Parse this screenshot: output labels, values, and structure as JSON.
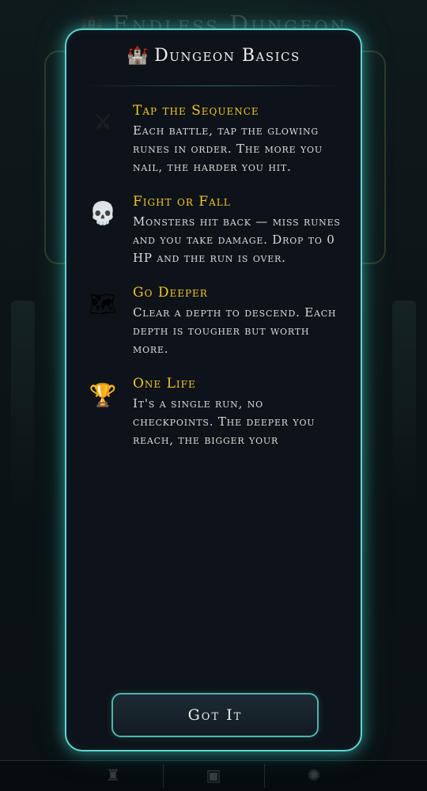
{
  "background": {
    "title": "Endless Dungeon",
    "nav_icons": [
      "castle-icon",
      "chest-icon",
      "medallion-icon"
    ]
  },
  "modal": {
    "title": "Dungeon Basics",
    "title_icon": "castle-icon",
    "rules": [
      {
        "icon": "swords-icon",
        "glyph": "⚔",
        "title": "Tap the Sequence",
        "text": "Each battle, tap the glowing runes in order. The more you nail, the harder you hit."
      },
      {
        "icon": "skull-icon",
        "glyph": "💀",
        "title": "Fight or Fall",
        "text": "Monsters hit back — miss runes and you take damage. Drop to 0 HP and the run is over."
      },
      {
        "icon": "map-icon",
        "glyph": "🗺",
        "title": "Go Deeper",
        "text": "Clear a depth to descend. Each depth is tougher but worth more."
      },
      {
        "icon": "trophy-icon",
        "glyph": "🏆",
        "title": "One Life",
        "text": "It's a single run, no checkpoints. The deeper you reach, the bigger your"
      }
    ],
    "button_label": "Got It"
  },
  "colors": {
    "accent": "#5fd4cd",
    "heading": "#f3c52a",
    "text": "#d9dcd8",
    "panel": "#0d1319"
  }
}
